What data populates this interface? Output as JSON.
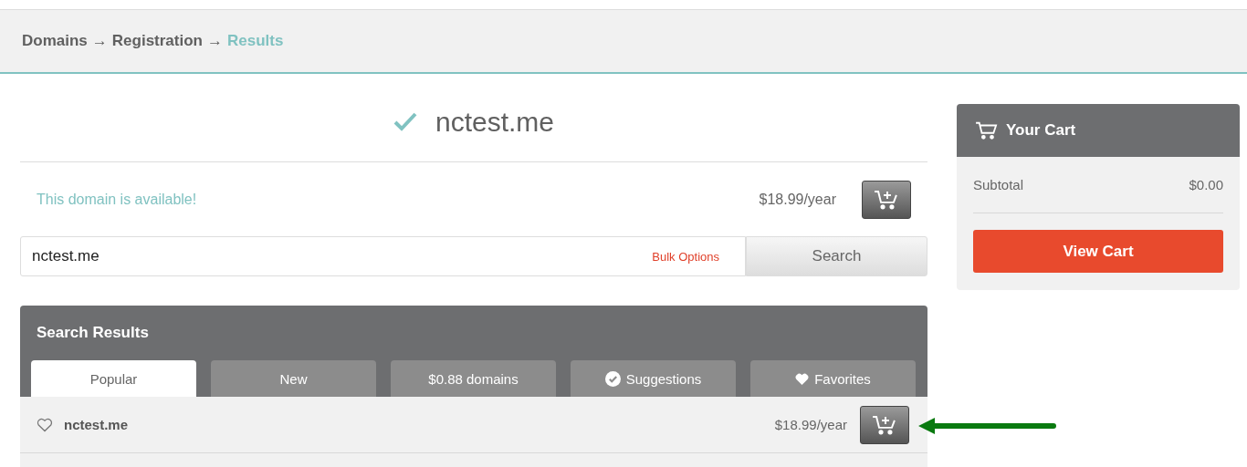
{
  "breadcrumb": [
    {
      "label": "Domains",
      "current": false
    },
    {
      "label": "Registration",
      "current": false
    },
    {
      "label": "Results",
      "current": true
    }
  ],
  "breadcrumb_separator": "→",
  "domain": {
    "name": "nctest.me",
    "available": true,
    "status": "This domain is available!",
    "price": "$18.99/year"
  },
  "search": {
    "value": "nctest.me",
    "bulk_options": "Bulk Options",
    "button": "Search"
  },
  "results": {
    "title": "Search Results",
    "tabs": [
      {
        "label": "Popular",
        "selected": true,
        "kind": "plain"
      },
      {
        "label": "New",
        "selected": false,
        "kind": "plain"
      },
      {
        "label": "$0.88 domains",
        "selected": false,
        "kind": "plain"
      },
      {
        "label": "Suggestions",
        "selected": false,
        "kind": "check"
      },
      {
        "label": "Favorites",
        "selected": false,
        "kind": "heart"
      }
    ],
    "rows": [
      {
        "domain": "nctest.me",
        "favorite": false,
        "price": "$18.99/year"
      }
    ]
  },
  "cart": {
    "title": "Your Cart",
    "subtotal_label": "Subtotal",
    "subtotal": "$0.00",
    "button": "View Cart"
  }
}
